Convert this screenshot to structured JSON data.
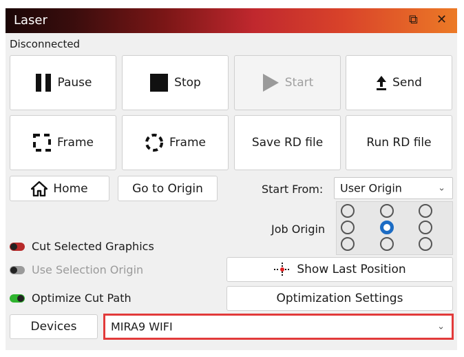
{
  "window": {
    "title": "Laser",
    "icons": [
      "restore-icon",
      "close-icon"
    ]
  },
  "status": "Disconnected",
  "buttons": {
    "pause": "Pause",
    "stop": "Stop",
    "start": "Start",
    "send": "Send",
    "frame_square": "Frame",
    "frame_circle": "Frame",
    "save_rd": "Save RD file",
    "run_rd": "Run RD file",
    "home": "Home",
    "go_to_origin": "Go to Origin",
    "show_last_position": "Show Last Position",
    "optimization_settings": "Optimization Settings",
    "devices": "Devices"
  },
  "start_from": {
    "label": "Start From:",
    "value": "User Origin"
  },
  "job_origin": {
    "label": "Job Origin",
    "selected_index": 4
  },
  "options": [
    {
      "label": "Cut Selected Graphics",
      "state": "off",
      "enabled": true
    },
    {
      "label": "Use Selection Origin",
      "state": "off",
      "enabled": false
    },
    {
      "label": "Optimize Cut Path",
      "state": "on",
      "enabled": true
    }
  ],
  "device": {
    "value": "MIRA9 WIFI"
  },
  "colors": {
    "highlight": "#e23a3a",
    "radio_selected": "#1c6cc4"
  }
}
